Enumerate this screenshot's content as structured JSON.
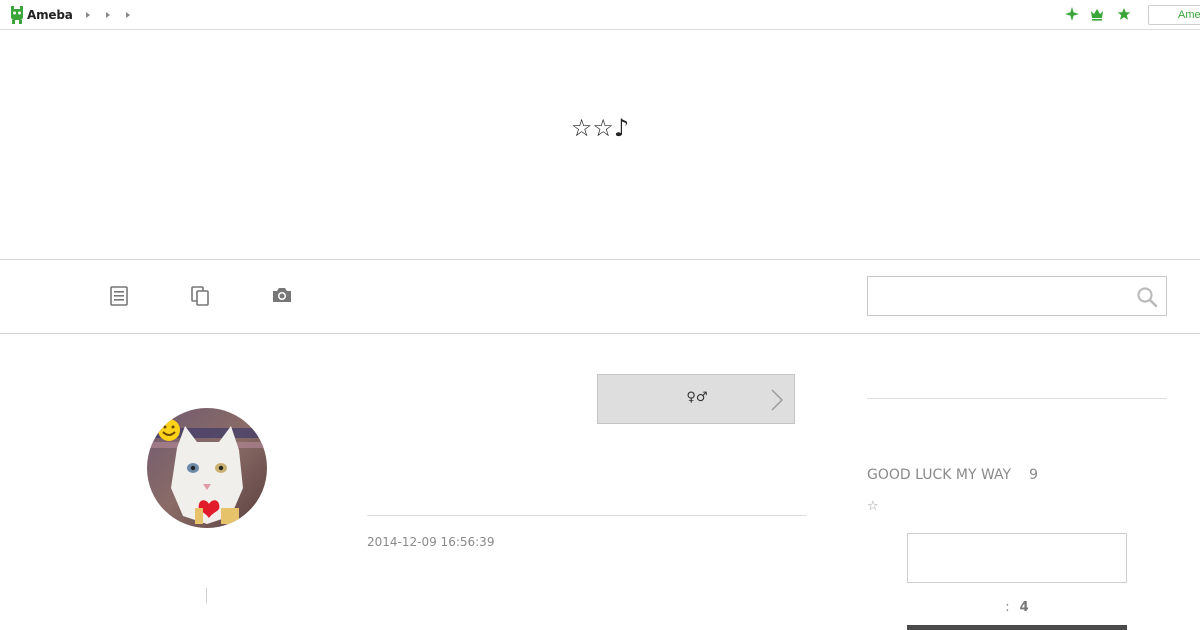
{
  "topbar": {
    "logo_text": "Ameba",
    "breadcrumb_count": 3,
    "icons": [
      "sparkle-icon",
      "crown-icon",
      "star-icon"
    ],
    "login_label": "Ameba",
    "accent_color": "#3aa539"
  },
  "header": {
    "blog_title": "☆☆♪"
  },
  "nav": {
    "icons": [
      "entry-list-icon",
      "pages-icon",
      "camera-icon"
    ],
    "search_placeholder": ""
  },
  "entry": {
    "theme_label": "♀♂",
    "date": "2014-12-09 16:56:39"
  },
  "sidebar": {
    "profile_name": "GOOD LUCK MY WAY",
    "profile_count": "9",
    "profile_star": "☆",
    "reader_label": ":",
    "reader_count": "4"
  }
}
